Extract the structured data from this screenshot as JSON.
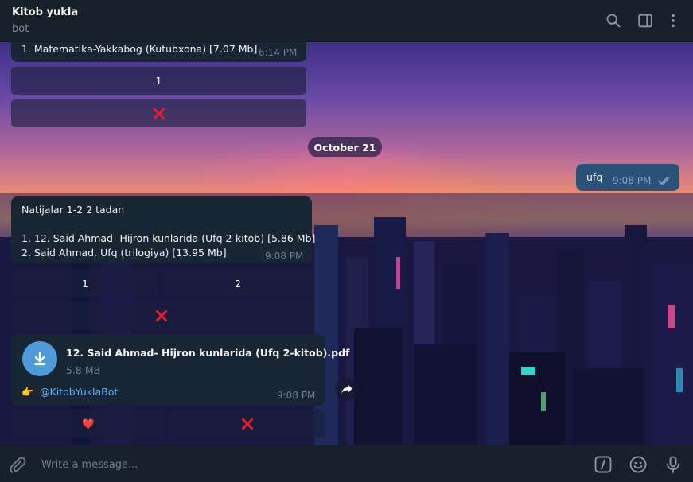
{
  "header": {
    "title": "Kitob yukla",
    "status": "bot",
    "icons": [
      "search-icon",
      "sidebar-toggle-icon",
      "more-vertical-icon"
    ]
  },
  "messages": {
    "m1": {
      "text_line": "1. Matematika-Yakkabog (Kutubxona) [7.07 Mb]",
      "time": "6:14 PM",
      "keyboard": {
        "row1": "1",
        "row2_icon": "cross-mark-icon"
      }
    },
    "date_separator": "October 21",
    "out1": {
      "text": "ufq",
      "time": "9:08 PM",
      "status_icon": "double-check-icon"
    },
    "m2": {
      "header_line": "Natijalar 1-2 2 tadan",
      "line1": "1. 12. Said Ahmad- Hijron kunlarida (Ufq 2-kitob) [5.86 Mb]",
      "line2": "2. Said Ahmad. Ufq (trilogiya) [13.95 Mb]",
      "time": "9:08 PM",
      "keyboard": {
        "btn1": "1",
        "btn2": "2",
        "row2_icon": "cross-mark-icon"
      }
    },
    "file": {
      "name": "12. Said Ahmad- Hijron kunlarida (Ufq 2-kitob).pdf",
      "size": "5.8 MB",
      "caption_emoji": "👉",
      "caption_link": "@KitobYuklaBot",
      "time": "9:08 PM",
      "keyboard": {
        "heart": "❤️",
        "close_icon": "cross-mark-icon"
      }
    }
  },
  "composer": {
    "placeholder": "Write a message...",
    "icons": [
      "attach-icon",
      "bot-commands-icon",
      "emoji-icon",
      "microphone-icon"
    ]
  },
  "colors": {
    "header_bg": "#17212b",
    "incoming_bubble": "#182533",
    "outgoing_bubble": "#2b5278",
    "accent": "#4f9ad8",
    "cross_red": "#e8202a"
  }
}
